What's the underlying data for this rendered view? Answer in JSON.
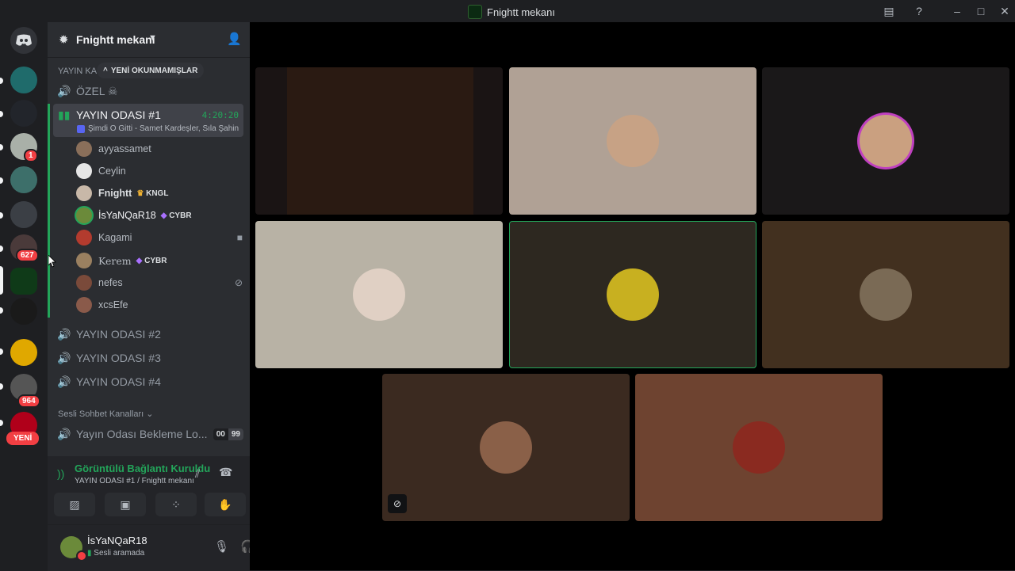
{
  "window": {
    "title": "Fnightt mekanı"
  },
  "guilds": {
    "badges": [
      "1",
      "627",
      "964"
    ],
    "new_label": "YENİ"
  },
  "server": {
    "name": "Fnightt mekanı"
  },
  "unread_banner": "YENİ OKUNMAMIŞLAR",
  "category_partial": "YAYIN KA",
  "channels": {
    "ozel": "ÖZEL ☠",
    "room1": {
      "name": "YAYIN ODASI #1",
      "timer": "4:20:20",
      "activity": "Şimdi O Gitti - Samet Kardeşler, Sıla Şahin"
    },
    "room2": "YAYIN ODASI #2",
    "room3": "YAYIN ODASI #3",
    "room4": "YAYIN ODASI #4",
    "voice_category": "Sesli Sohbet Kanalları",
    "waiting": {
      "name": "Yayın Odası Bekleme Lo...",
      "count_a": "00",
      "count_b": "99"
    }
  },
  "voice_users": [
    {
      "name": "ayyassamet",
      "tag": ""
    },
    {
      "name": "Ceylin",
      "tag": ""
    },
    {
      "name": "Fnightt",
      "tag": "KNGL"
    },
    {
      "name": "İsYaNQaR18",
      "tag": "CYBR"
    },
    {
      "name": "Kagami",
      "tag": ""
    },
    {
      "name": "Kerem",
      "tag": "CYBR"
    },
    {
      "name": "nefes",
      "tag": ""
    },
    {
      "name": "xcsEfe",
      "tag": ""
    }
  ],
  "rtc": {
    "status": "Görüntülü Bağlantı Kuruldu",
    "location": "YAYIN ODASI #1 / Fnightt mekanı"
  },
  "account": {
    "username": "İsYaNQaR18",
    "status": "Sesli aramada"
  },
  "colors": {
    "accent_green": "#23a55a",
    "danger": "#f23f43",
    "sidebar": "#2b2d31",
    "rail": "#1e1f22"
  }
}
